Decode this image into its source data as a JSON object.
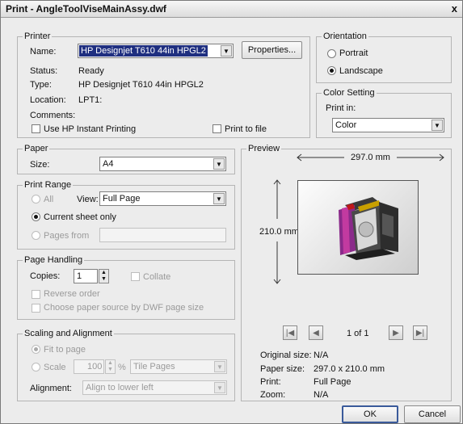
{
  "window": {
    "title": "Print - AngleToolViseMainAssy.dwf",
    "close_label": "x"
  },
  "printer": {
    "legend": "Printer",
    "name_label": "Name:",
    "name_value": "HP Designjet T610 44in HPGL2",
    "properties_button": "Properties...",
    "status_label": "Status:",
    "status_value": "Ready",
    "type_label": "Type:",
    "type_value": "HP Designjet T610 44in HPGL2",
    "location_label": "Location:",
    "location_value": "LPT1:",
    "comments_label": "Comments:",
    "instant_printing_label": "Use HP Instant Printing",
    "print_to_file_label": "Print to file"
  },
  "orientation": {
    "legend": "Orientation",
    "portrait_label": "Portrait",
    "landscape_label": "Landscape",
    "selected": "Landscape"
  },
  "color_setting": {
    "legend": "Color Setting",
    "print_in_label": "Print in:",
    "value": "Color"
  },
  "paper": {
    "legend": "Paper",
    "size_label": "Size:",
    "size_value": "A4"
  },
  "print_range": {
    "legend": "Print Range",
    "all_label": "All",
    "view_label": "View:",
    "view_value": "Full Page",
    "current_sheet_label": "Current sheet only",
    "pages_from_label": "Pages from",
    "pages_from_value": ""
  },
  "page_handling": {
    "legend": "Page Handling",
    "copies_label": "Copies:",
    "copies_value": "1",
    "collate_label": "Collate",
    "reverse_label": "Reverse order",
    "paper_source_label": "Choose paper source by DWF page size"
  },
  "scaling": {
    "legend": "Scaling and Alignment",
    "fit_label": "Fit to page",
    "scale_label": "Scale",
    "scale_value": "100",
    "percent_label": "%",
    "tile_value": "Tile Pages",
    "alignment_label": "Alignment:",
    "alignment_value": "Align to lower left"
  },
  "preview": {
    "legend": "Preview",
    "width_dim": "297.0 mm",
    "height_dim": "210.0 mm",
    "page_text": "1 of 1",
    "original_size_label": "Original size:",
    "original_size_value": "N/A",
    "paper_size_label": "Paper size:",
    "paper_size_value": "297.0 x 210.0 mm",
    "print_label": "Print:",
    "print_value": "Full Page",
    "zoom_label": "Zoom:",
    "zoom_value": "N/A"
  },
  "buttons": {
    "ok": "OK",
    "cancel": "Cancel"
  }
}
